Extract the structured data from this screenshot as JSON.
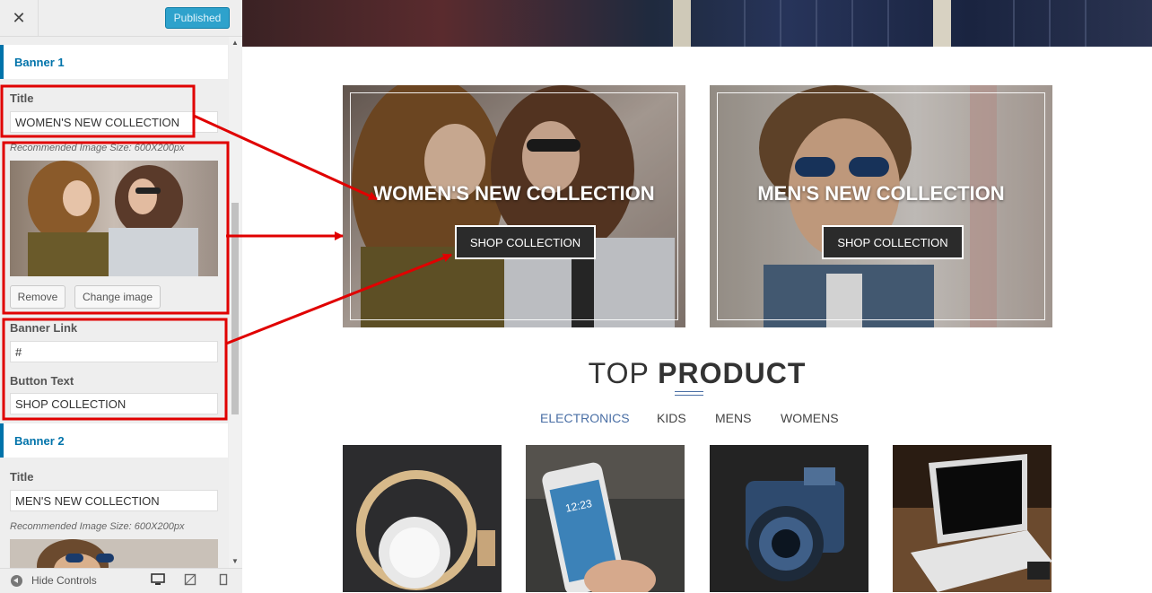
{
  "topbar": {
    "close_glyph": "✕",
    "publish_label": "Published"
  },
  "sidebar": {
    "banner1": {
      "heading": "Banner 1",
      "title_label": "Title",
      "title_value": "WOMEN'S NEW COLLECTION",
      "image_hint": "Recommended Image Size: 600X200px",
      "remove_label": "Remove",
      "change_label": "Change image",
      "link_label": "Banner Link",
      "link_value": "#",
      "button_text_label": "Button Text",
      "button_text_value": "SHOP COLLECTION"
    },
    "banner2": {
      "heading": "Banner 2",
      "title_label": "Title",
      "title_value": "MEN'S NEW COLLECTION",
      "image_hint": "Recommended Image Size: 600X200px"
    },
    "footer": {
      "hide_label": "Hide Controls"
    }
  },
  "preview": {
    "banners": [
      {
        "title": "WOMEN'S NEW COLLECTION",
        "button": "SHOP COLLECTION"
      },
      {
        "title": "MEN'S NEW COLLECTION",
        "button": "SHOP COLLECTION"
      }
    ],
    "section_title_light": "TOP ",
    "section_title_bold": "PRODUCT",
    "tabs": [
      "ELECTRONICS",
      "KIDS",
      "MENS",
      "WOMENS"
    ],
    "active_tab": "ELECTRONICS",
    "products": [
      "headphones",
      "smartphone",
      "camera",
      "laptop"
    ]
  },
  "colors": {
    "accent": "#0073aa",
    "publish": "#2ea2cc",
    "annotation": "#e00000",
    "tab_active": "#4a6fa5"
  }
}
